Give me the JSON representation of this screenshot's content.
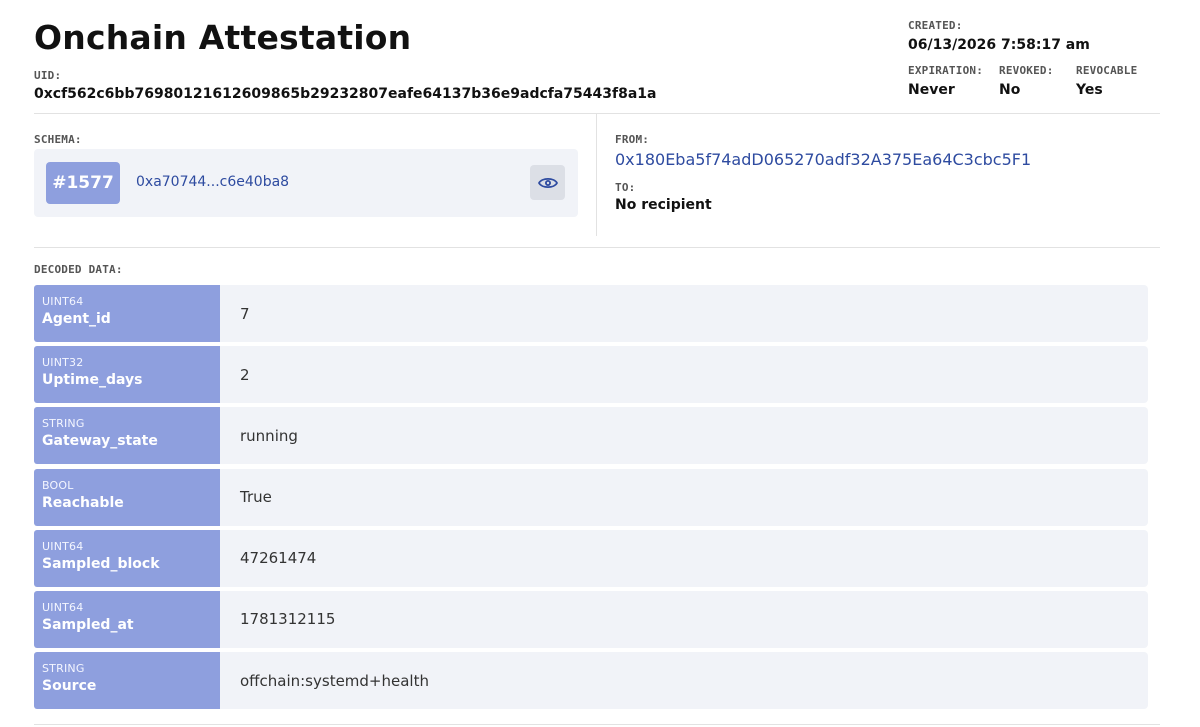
{
  "header": {
    "title": "Onchain Attestation",
    "uid_label": "UID:",
    "uid": "0xcf562c6bb76980121612609865b29232807eafe64137b36e9adcfa75443f8a1a"
  },
  "meta": {
    "created_label": "CREATED:",
    "created": "06/13/2026 7:58:17 am",
    "expiration_label": "EXPIRATION:",
    "expiration": "Never",
    "revoked_label": "REVOKED:",
    "revoked": "No",
    "revocable_label": "REVOCABLE",
    "revocable": "Yes"
  },
  "schema": {
    "label": "SCHEMA:",
    "badge": "#1577",
    "hash": "0xa70744...c6e40ba8",
    "view_icon": "eye-icon"
  },
  "parties": {
    "from_label": "FROM:",
    "from": "0x180Eba5f74adD065270adf32A375Ea64C3cbc5F1",
    "to_label": "TO:",
    "to": "No recipient"
  },
  "decoded": {
    "label": "DECODED DATA:",
    "rows": [
      {
        "type": "UINT64",
        "name": "Agent_id",
        "value": "7"
      },
      {
        "type": "UINT32",
        "name": "Uptime_days",
        "value": "2"
      },
      {
        "type": "STRING",
        "name": "Gateway_state",
        "value": "running"
      },
      {
        "type": "BOOL",
        "name": "Reachable",
        "value": "True"
      },
      {
        "type": "UINT64",
        "name": "Sampled_block",
        "value": "47261474"
      },
      {
        "type": "UINT64",
        "name": "Sampled_at",
        "value": "1781312115"
      },
      {
        "type": "STRING",
        "name": "Source",
        "value": "offchain:systemd+health"
      }
    ]
  },
  "colors": {
    "accent": "#8e9fde",
    "link": "#2e4ba0",
    "panel": "#f1f3f8"
  }
}
